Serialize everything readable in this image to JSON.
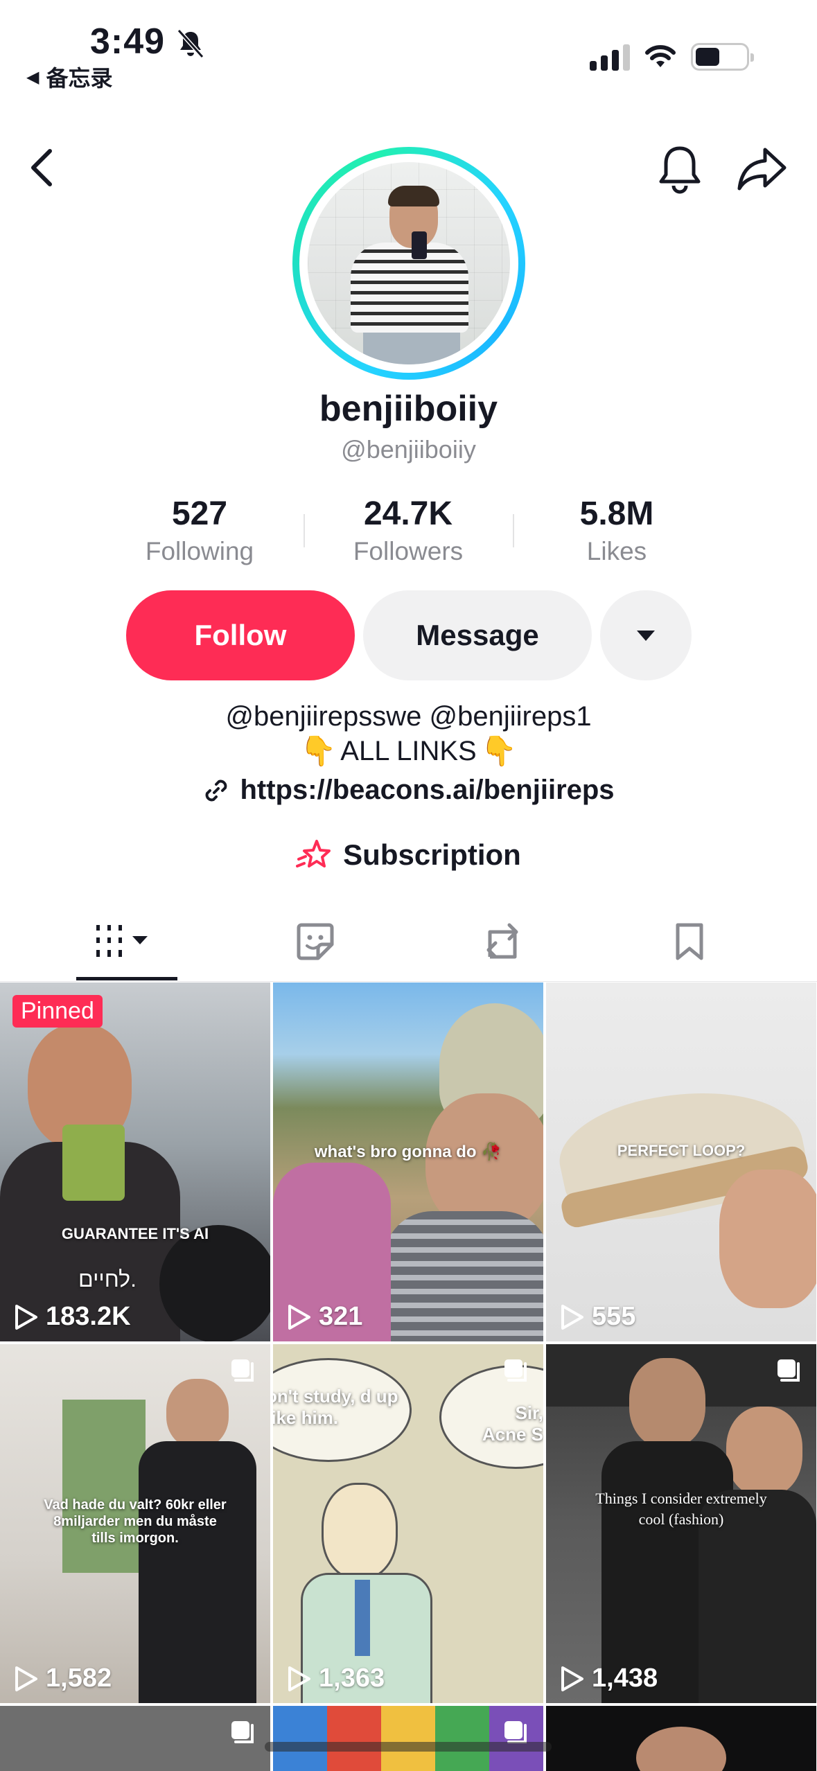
{
  "status_bar": {
    "time": "3:49",
    "back_app": "备忘录",
    "back_arrow": "◀"
  },
  "header": {
    "icons": [
      "back-icon",
      "bell-icon",
      "share-icon"
    ]
  },
  "profile": {
    "display_name": "benjiiboiiy",
    "handle": "@benjiiboiiy",
    "stats": [
      {
        "value": "527",
        "label": "Following"
      },
      {
        "value": "24.7K",
        "label": "Followers"
      },
      {
        "value": "5.8M",
        "label": "Likes"
      }
    ],
    "buttons": {
      "follow": "Follow",
      "message": "Message"
    },
    "bio": {
      "line1": "@benjiirepsswe @benjiireps1",
      "line2": "ALL LINKS",
      "link": "https://beacons.ai/benjiireps"
    },
    "subscription": "Subscription"
  },
  "tabs": [
    "videos-tab",
    "liked-tab",
    "reposts-tab",
    "favorites-tab"
  ],
  "videos": [
    {
      "views": "183.2K",
      "pinned": "Pinned",
      "caption": "GUARANTEE IT'S AI",
      "caption2": "לחיים."
    },
    {
      "views": "321",
      "caption": "what's bro gonna do 🥀"
    },
    {
      "views": "555",
      "caption": "PERFECT LOOP?"
    },
    {
      "views": "1,582",
      "caption": "Vad hade du valt? 60kr eller 8miljarder men du måste tills imorgon."
    },
    {
      "views": "1,363",
      "caption": "on't study, d up like him.",
      "caption2": "Sir, Acne S"
    },
    {
      "views": "1,438",
      "caption": "Things I consider extremely cool (fashion)"
    }
  ],
  "colors": {
    "accent": "#fe2c55",
    "ring_a": "#25d3ff",
    "ring_b": "#22f0b0",
    "text": "#161823",
    "muted": "#8a8b91"
  }
}
